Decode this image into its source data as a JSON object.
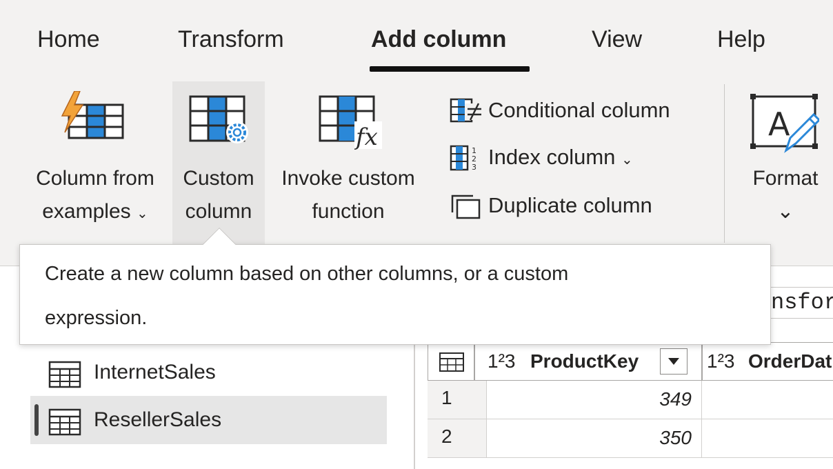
{
  "tabs": [
    {
      "label": "Home"
    },
    {
      "label": "Transform"
    },
    {
      "label": "Add column"
    },
    {
      "label": "View"
    },
    {
      "label": "Help"
    }
  ],
  "ribbon": {
    "column_from_examples": {
      "line1": "Column from",
      "line2": "examples",
      "chevron": "⌄"
    },
    "custom_column": {
      "line1": "Custom",
      "line2": "column"
    },
    "invoke_custom_function": {
      "line1": "Invoke custom",
      "line2": "function"
    },
    "conditional_column": {
      "label": "Conditional column"
    },
    "index_column": {
      "label": "Index column",
      "chevron": "⌄"
    },
    "duplicate_column": {
      "label": "Duplicate column"
    },
    "format": {
      "label": "Format",
      "chevron": "⌄"
    }
  },
  "tooltip": {
    "line1": "Create a new column based on other columns, or a custom",
    "line2": "expression."
  },
  "queries": [
    {
      "label": "InternetSales",
      "selected": false
    },
    {
      "label": "ResellerSales",
      "selected": true
    }
  ],
  "formula": {
    "text": "nsfor"
  },
  "grid": {
    "columns": [
      {
        "type": "1²3",
        "name": "ProductKey"
      },
      {
        "type": "1²3",
        "name": "OrderDat"
      }
    ],
    "rows": [
      {
        "num": "1",
        "productkey": "349"
      },
      {
        "num": "2",
        "productkey": "350"
      }
    ]
  },
  "colors": {
    "ribbon_bg": "#f3f2f1",
    "accent_blue": "#2b88d8",
    "lightning_orange": "#f2a33a"
  }
}
